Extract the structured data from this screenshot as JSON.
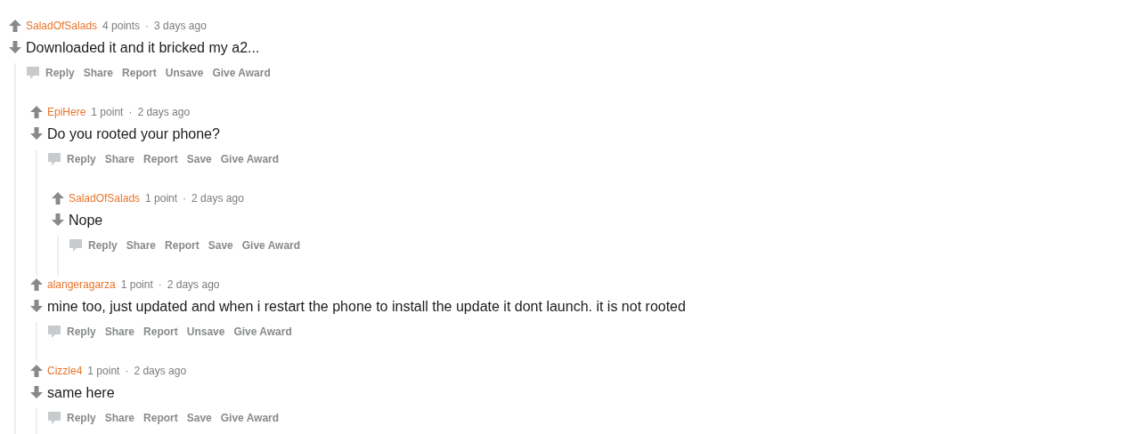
{
  "comments": [
    {
      "author": "SaladOfSalads",
      "score": "4 points",
      "separator": "·",
      "time": "3 days ago",
      "body": "Downloaded it and it bricked my a2...",
      "actions": [
        {
          "label": "Reply",
          "kind": "reply"
        },
        {
          "label": "Share",
          "kind": "plain"
        },
        {
          "label": "Report",
          "kind": "plain"
        },
        {
          "label": "Unsave",
          "kind": "plain"
        },
        {
          "label": "Give Award",
          "kind": "plain"
        }
      ],
      "children": [
        {
          "author": "EpiHere",
          "score": "1 point",
          "separator": "·",
          "time": "2 days ago",
          "body": "Do you rooted your phone?",
          "actions": [
            {
              "label": "Reply",
              "kind": "reply"
            },
            {
              "label": "Share",
              "kind": "plain"
            },
            {
              "label": "Report",
              "kind": "plain"
            },
            {
              "label": "Save",
              "kind": "plain"
            },
            {
              "label": "Give Award",
              "kind": "plain"
            }
          ],
          "children": [
            {
              "author": "SaladOfSalads",
              "score": "1 point",
              "separator": "·",
              "time": "2 days ago",
              "body": "Nope",
              "actions": [
                {
                  "label": "Reply",
                  "kind": "reply"
                },
                {
                  "label": "Share",
                  "kind": "plain"
                },
                {
                  "label": "Report",
                  "kind": "plain"
                },
                {
                  "label": "Save",
                  "kind": "plain"
                },
                {
                  "label": "Give Award",
                  "kind": "plain"
                }
              ]
            }
          ]
        },
        {
          "author": "alangeragarza",
          "score": "1 point",
          "separator": "·",
          "time": "2 days ago",
          "body": "mine too, just updated and when i restart the phone to install the update it dont launch. it is not rooted",
          "actions": [
            {
              "label": "Reply",
              "kind": "reply"
            },
            {
              "label": "Share",
              "kind": "plain"
            },
            {
              "label": "Report",
              "kind": "plain"
            },
            {
              "label": "Unsave",
              "kind": "plain"
            },
            {
              "label": "Give Award",
              "kind": "plain"
            }
          ]
        },
        {
          "author": "Cizzle4",
          "score": "1 point",
          "separator": "·",
          "time": "2 days ago",
          "body": "same here",
          "actions": [
            {
              "label": "Reply",
              "kind": "reply"
            },
            {
              "label": "Share",
              "kind": "plain"
            },
            {
              "label": "Report",
              "kind": "plain"
            },
            {
              "label": "Save",
              "kind": "plain"
            },
            {
              "label": "Give Award",
              "kind": "plain"
            }
          ]
        }
      ]
    }
  ]
}
